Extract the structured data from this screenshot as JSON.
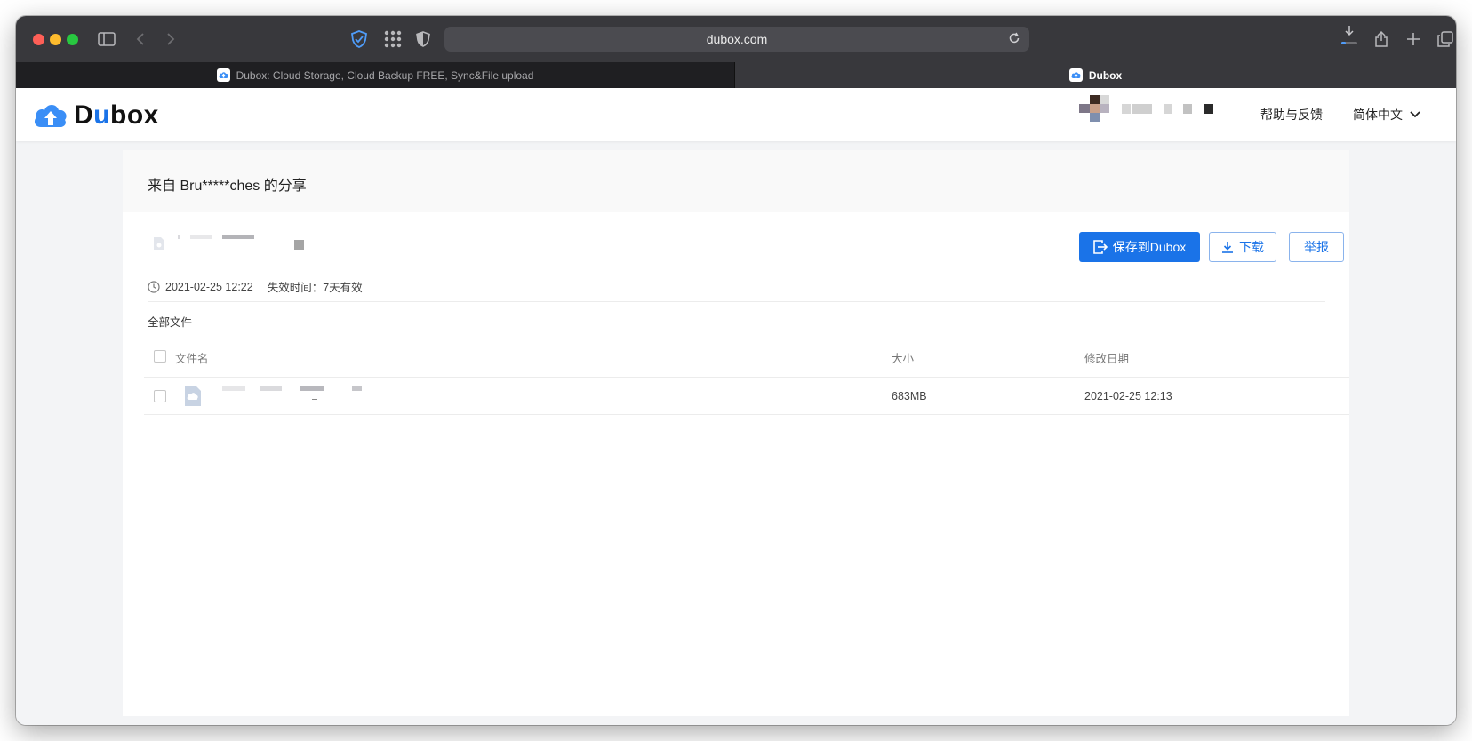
{
  "browser": {
    "url": "dubox.com",
    "tabs": [
      {
        "title": "Dubox: Cloud Storage, Cloud Backup FREE, Sync&File upload",
        "active": false
      },
      {
        "title": "Dubox",
        "active": true
      }
    ],
    "icons": [
      "sidebar-icon",
      "back-icon",
      "forward-icon",
      "shield-check-icon",
      "grid-icon",
      "privacy-icon",
      "reload-icon",
      "download-icon",
      "share-icon",
      "new-tab-icon",
      "tab-overview-icon"
    ]
  },
  "header": {
    "logo": {
      "prefix": "D",
      "accent": "u",
      "suffix": "box"
    },
    "help_label": "帮助与反馈",
    "language_label": "简体中文",
    "brand_color": "#1a73e8"
  },
  "share": {
    "title": "来自 Bru*****ches 的分享",
    "buttons": {
      "save": "保存到Dubox",
      "download": "下载",
      "report": "举报"
    },
    "created": "2021-02-25 12:22",
    "expiry": "失效时间：7天有效",
    "breadcrumb": "全部文件"
  },
  "table": {
    "columns": {
      "name": "文件名",
      "size": "大小",
      "modified": "修改日期"
    },
    "rows": [
      {
        "size": "683MB",
        "modified": "2021-02-25 12:13"
      }
    ]
  }
}
